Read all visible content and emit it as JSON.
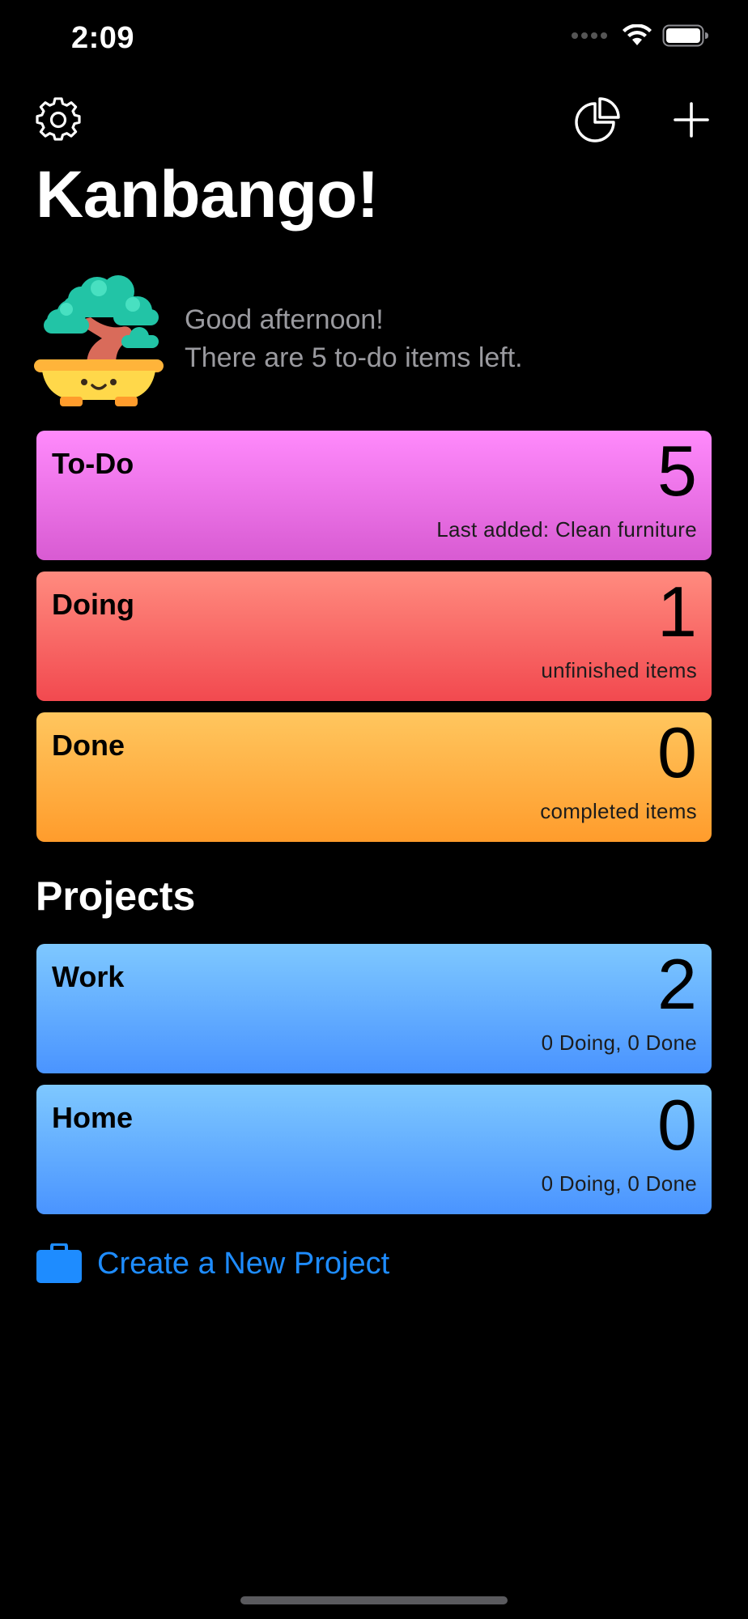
{
  "status_bar": {
    "time": "2:09",
    "icons": [
      "signal-icon",
      "wifi-icon",
      "battery-icon"
    ]
  },
  "toolbar": {
    "icons": [
      "gear-icon",
      "pie-chart-icon",
      "plus-icon"
    ]
  },
  "app": {
    "title": "Kanbango!"
  },
  "greeting": {
    "line1": "Good afternoon!",
    "line2": "There are 5 to-do items left.",
    "mascot": "bonsai-icon"
  },
  "status_cards": [
    {
      "label": "To-Do",
      "count": "5",
      "subtitle": "Last added: Clean furniture",
      "color_top": "#ff8afc",
      "color_bottom": "#d85bd2"
    },
    {
      "label": "Doing",
      "count": "1",
      "subtitle": "unfinished items",
      "color_top": "#ff8b7f",
      "color_bottom": "#f2494f"
    },
    {
      "label": "Done",
      "count": "0",
      "subtitle": "completed items",
      "color_top": "#ffc65e",
      "color_bottom": "#ff9c2c"
    }
  ],
  "projects": {
    "section_title": "Projects",
    "items": [
      {
        "label": "Work",
        "count": "2",
        "subtitle": "0 Doing, 0 Done"
      },
      {
        "label": "Home",
        "count": "0",
        "subtitle": "0 Doing, 0 Done"
      }
    ],
    "color_top": "#7ec8ff",
    "color_bottom": "#4a94ff",
    "create_label": "Create a New Project",
    "create_icon": "briefcase-icon",
    "accent": "#1e8cff"
  }
}
